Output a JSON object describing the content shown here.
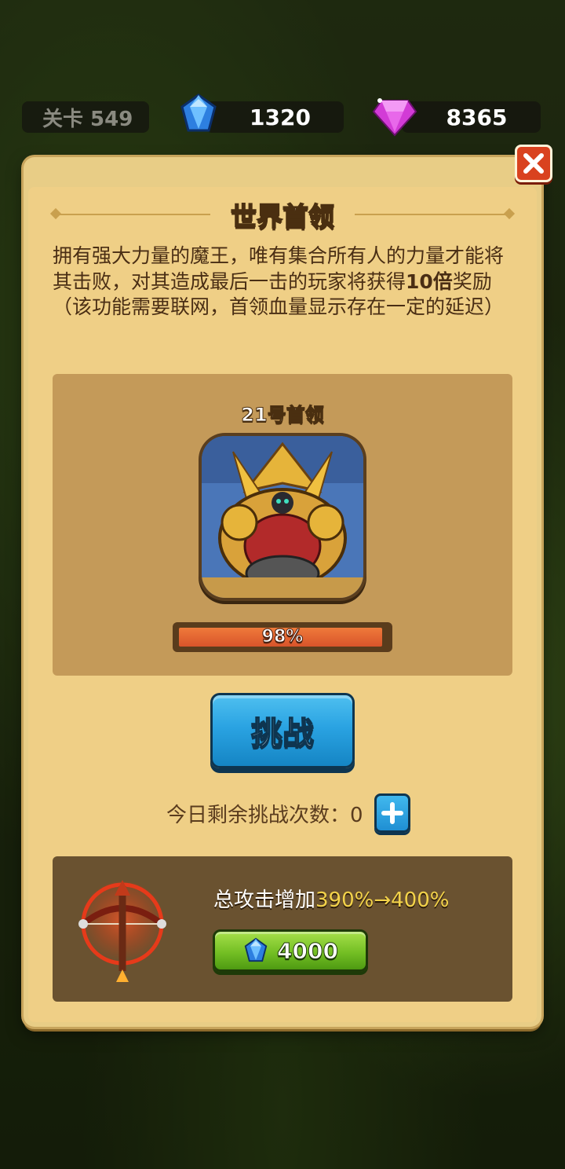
{
  "hud": {
    "level_label": "关卡 549",
    "blue_gems": "1320",
    "pink_gems": "8365"
  },
  "dialog": {
    "title": "世界首领",
    "description_part1": "拥有强大力量的魔王，唯有集合所有人的力量才能将其击败，对其造成最后一击的玩家将获得",
    "description_bold": "10倍",
    "description_part2": "奖励（该功能需要联网，首领血量显示存在一定的延迟）",
    "boss_name": "21号首领",
    "boss_hp_text": "98%",
    "boss_hp_fraction": 0.98,
    "challenge_label": "挑战",
    "remaining_label": "今日剩余挑战次数：0",
    "upgrade_label": "总攻击增加",
    "upgrade_value": "390%→400%",
    "upgrade_cost": "4000"
  },
  "colors": {
    "panel_bg": "#efcf86",
    "challenge_blue": "#2aa3e2",
    "buy_green": "#74bf24",
    "hp_orange": "#e0602e",
    "highlight_yellow": "#f2d24a"
  },
  "icons": {
    "blue_gem": "blue-gem-icon",
    "pink_gem": "pink-diamond-icon",
    "close": "close-icon",
    "plus": "plus-icon",
    "crossbow": "crossbow-icon",
    "boss": "boss-portrait"
  }
}
